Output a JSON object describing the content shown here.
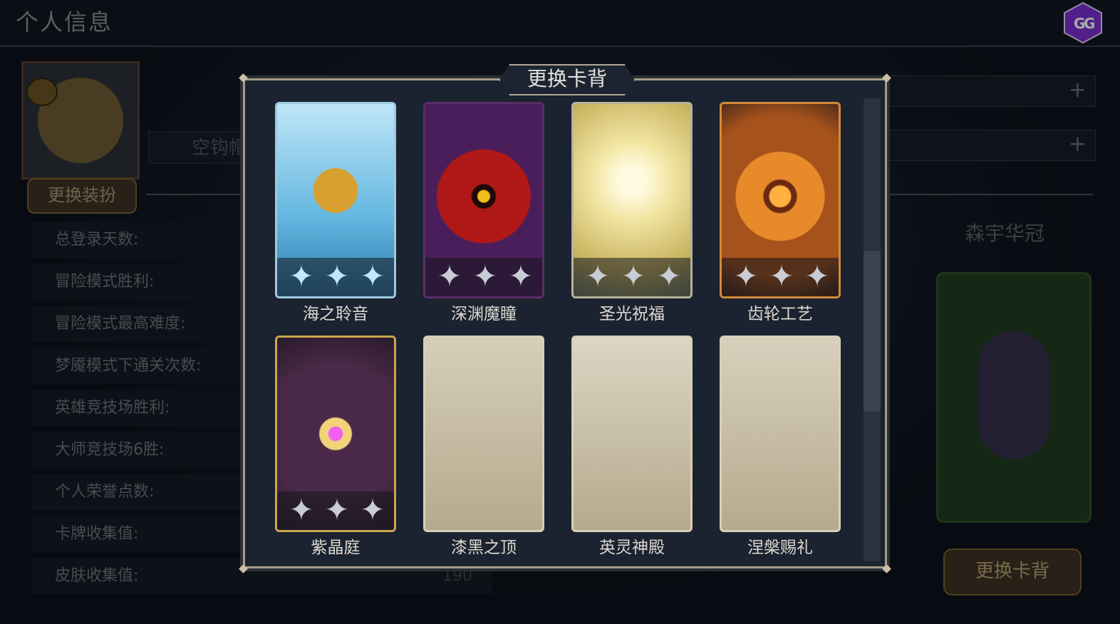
{
  "page": {
    "title": "个人信息"
  },
  "profile": {
    "change_outfit": "更换装扮",
    "nickname": "空钩帽...",
    "stats": [
      {
        "label": "总登录天数:"
      },
      {
        "label": "冒险模式胜利:"
      },
      {
        "label": "冒险模式最高难度:"
      },
      {
        "label": "梦魇模式下通关次数:"
      },
      {
        "label": "英雄竞技场胜利:"
      },
      {
        "label": "大师竞技场6胜:"
      },
      {
        "label": "个人荣誉点数:"
      },
      {
        "label": "卡牌收集值:"
      },
      {
        "label": "皮肤收集值:",
        "value": "190"
      }
    ]
  },
  "right_panel": {
    "name": "森宇华冠",
    "change_back": "更换卡背"
  },
  "modal": {
    "title": "更换卡背",
    "cards": [
      {
        "name": "海之聆音",
        "style": "sea",
        "stars": 3,
        "colors": [
          "#62b6e0",
          "#d8a030"
        ]
      },
      {
        "name": "深渊魔瞳",
        "style": "abyss",
        "stars": 3,
        "colors": [
          "#4a1e5a",
          "#b01818"
        ]
      },
      {
        "name": "圣光祝福",
        "style": "holy",
        "stars": 3,
        "colors": [
          "#c9b460",
          "#f2e6a4"
        ]
      },
      {
        "name": "齿轮工艺",
        "style": "gear",
        "stars": 3,
        "colors": [
          "#a5521c",
          "#e88a2a"
        ]
      },
      {
        "name": "紫晶庭",
        "style": "amethyst",
        "stars": 3,
        "colors": [
          "#4a2a48",
          "#c9a84a"
        ]
      },
      {
        "name": "漆黑之顶",
        "style": "locked",
        "stars": 0,
        "colors": [
          "#b5aa8e",
          "#d6ceb8"
        ]
      },
      {
        "name": "英灵神殿",
        "style": "locked",
        "stars": 0,
        "colors": [
          "#b5aa8e",
          "#dcd5c2"
        ]
      },
      {
        "name": "涅槃赐礼",
        "style": "locked",
        "stars": 0,
        "colors": [
          "#b5aa8e",
          "#d8d0bc"
        ]
      }
    ]
  }
}
